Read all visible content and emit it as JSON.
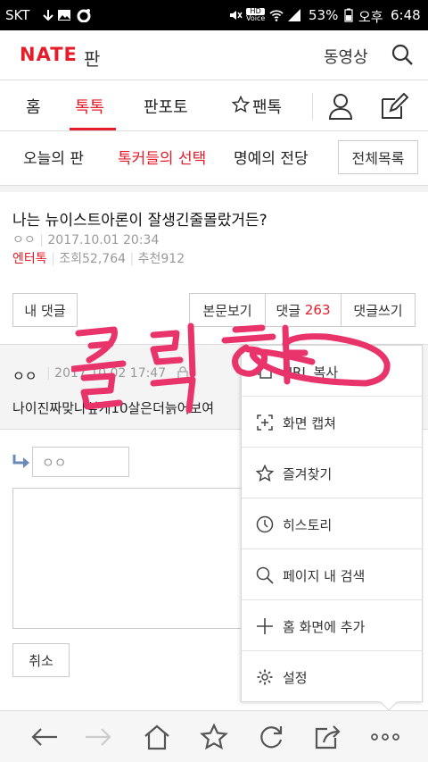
{
  "status": {
    "carrier": "SKT",
    "battery": "53%",
    "ampm": "오후",
    "time": "6:48",
    "hd": "HD",
    "voice": "Voice"
  },
  "header": {
    "logo": "NATE",
    "logo_sub": "판",
    "video": "동영상"
  },
  "tabs": [
    "홈",
    "톡톡",
    "판포토",
    "팬톡"
  ],
  "subtabs": [
    "오늘의 판",
    "톡커들의 선택",
    "명예의 전당"
  ],
  "all_list": "전체목록",
  "post": {
    "title": "나는 뉴이스트아론이 잘생긴줄몰랐거든?",
    "author": "ㅇㅇ",
    "date": "2017.10.01 20:34",
    "category": "엔터톡",
    "views": "조회52,764",
    "recommend": "추천912"
  },
  "actions": {
    "my_comment": "내 댓글",
    "view_body": "본문보기",
    "comment_label": "댓글",
    "comment_count": "263",
    "write_comment": "댓글쓰기"
  },
  "comment": {
    "author": "ㅇㅇ",
    "date": "2017.10.02 17:47",
    "text": "나이진짜맞나싶게10살은더늙어보여"
  },
  "reply": {
    "name_value": "ㅇㅇ",
    "cancel": "취소"
  },
  "annotation": "클릭",
  "menu": [
    {
      "label": "URL 복사",
      "icon": "copy-icon"
    },
    {
      "label": "화면 캡쳐",
      "icon": "capture-icon"
    },
    {
      "label": "즐겨찾기",
      "icon": "star-icon"
    },
    {
      "label": "히스토리",
      "icon": "clock-icon"
    },
    {
      "label": "페이지 내 검색",
      "icon": "search-icon"
    },
    {
      "label": "홈 화면에 추가",
      "icon": "plus-icon"
    },
    {
      "label": "설정",
      "icon": "gear-icon"
    }
  ],
  "colors": {
    "accent": "#e51d2a",
    "annotation": "#e8336b"
  }
}
